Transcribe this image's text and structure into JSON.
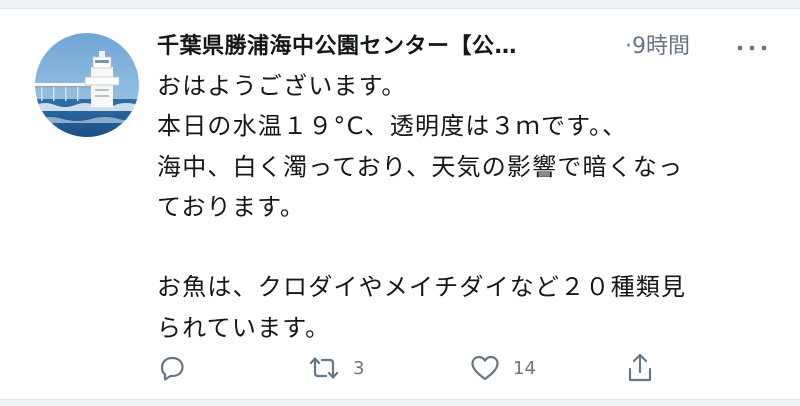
{
  "tweet": {
    "account_name": "千葉県勝浦海中公園センター【公…",
    "separator": "·",
    "time": "9時間",
    "avatar_icon": "underwater-observatory-tower-avatar",
    "more_icon": "more-horizontal-icon",
    "text": "おはようございます。\n本日の水温１９°C、透明度は３ｍです。、\n海中、白く濁っており、天気の影響で暗くなっ\nております。\n\nお魚は、クロダイやメイチダイなど２０種類見\nられています。",
    "actions": {
      "reply_icon": "reply-icon",
      "retweet_icon": "retweet-icon",
      "retweet_count": "3",
      "like_icon": "heart-icon",
      "like_count": "14",
      "share_icon": "share-icon"
    },
    "colors": {
      "text": "#14171a",
      "secondary": "#657786"
    }
  }
}
